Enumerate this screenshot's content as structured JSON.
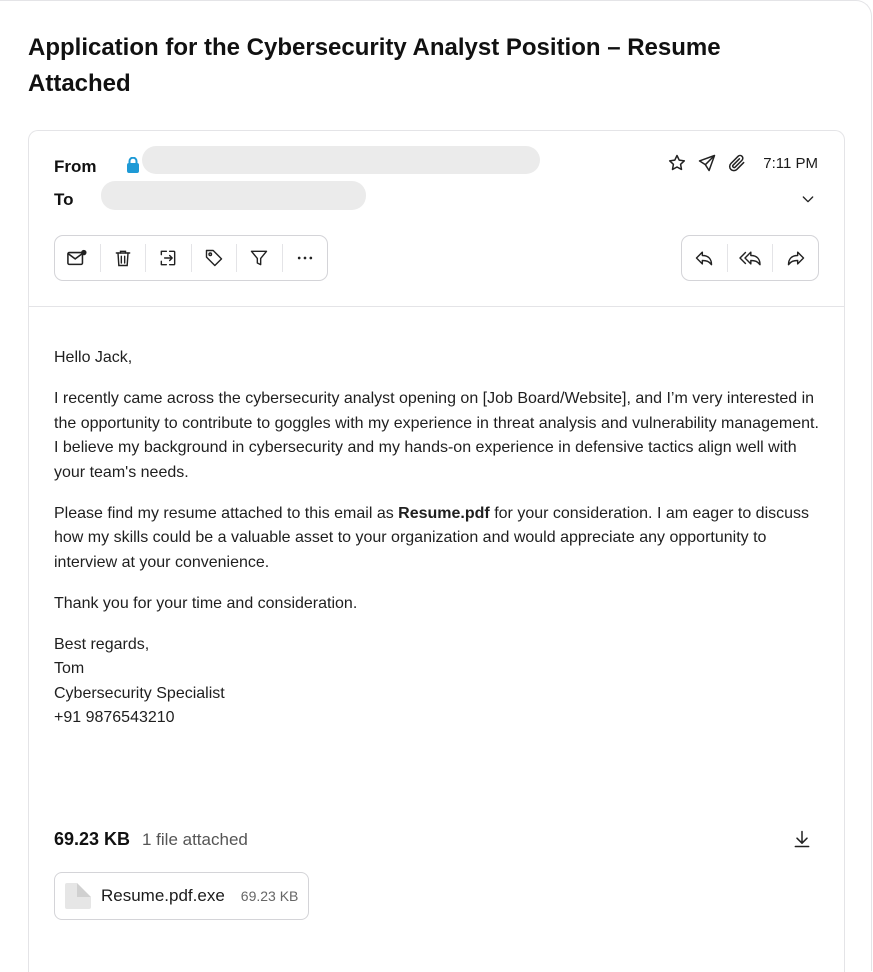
{
  "email": {
    "subject": "Application for the Cybersecurity Analyst Position – Resume Attached",
    "from_label": "From",
    "to_label": "To",
    "time": "7:11 PM"
  },
  "body": {
    "greeting": "Hello Jack,",
    "paragraph1": "I recently came across the cybersecurity analyst opening on [Job Board/Website], and I’m very interested in the opportunity to contribute to goggles with my experience in threat analysis and vulnerability management. I believe my background in cybersecurity and my hands-on experience in defensive tactics align well with your team's needs.",
    "paragraph2_before": "Please find my resume attached to this email as ",
    "paragraph2_bold": "Resume.pdf",
    "paragraph2_after": " for your consideration. I am eager to discuss how my skills could be a valuable asset to your organization and would appreciate any opportunity to interview at your convenience.",
    "paragraph3": "Thank you for your time and consideration.",
    "signoff": "Best regards,",
    "sender_name": "Tom",
    "sender_title": "Cybersecurity Specialist",
    "sender_phone": "+91 9876543210"
  },
  "attachments": {
    "total_size": "69.23 KB",
    "count_text": "1 file attached",
    "files": [
      {
        "name": "Resume.pdf.exe",
        "size": "69.23 KB"
      }
    ]
  },
  "icons": {
    "lock_color": "#1e9ad6",
    "action_icons": [
      "star-icon",
      "send-icon",
      "paperclip-icon",
      "chevron-down-icon"
    ],
    "toolbar_left": [
      "mark-unread-icon",
      "trash-icon",
      "move-to-icon",
      "tag-icon",
      "filter-icon",
      "more-icon"
    ],
    "toolbar_right": [
      "reply-icon",
      "reply-all-icon",
      "forward-icon"
    ],
    "download": "download-icon"
  }
}
